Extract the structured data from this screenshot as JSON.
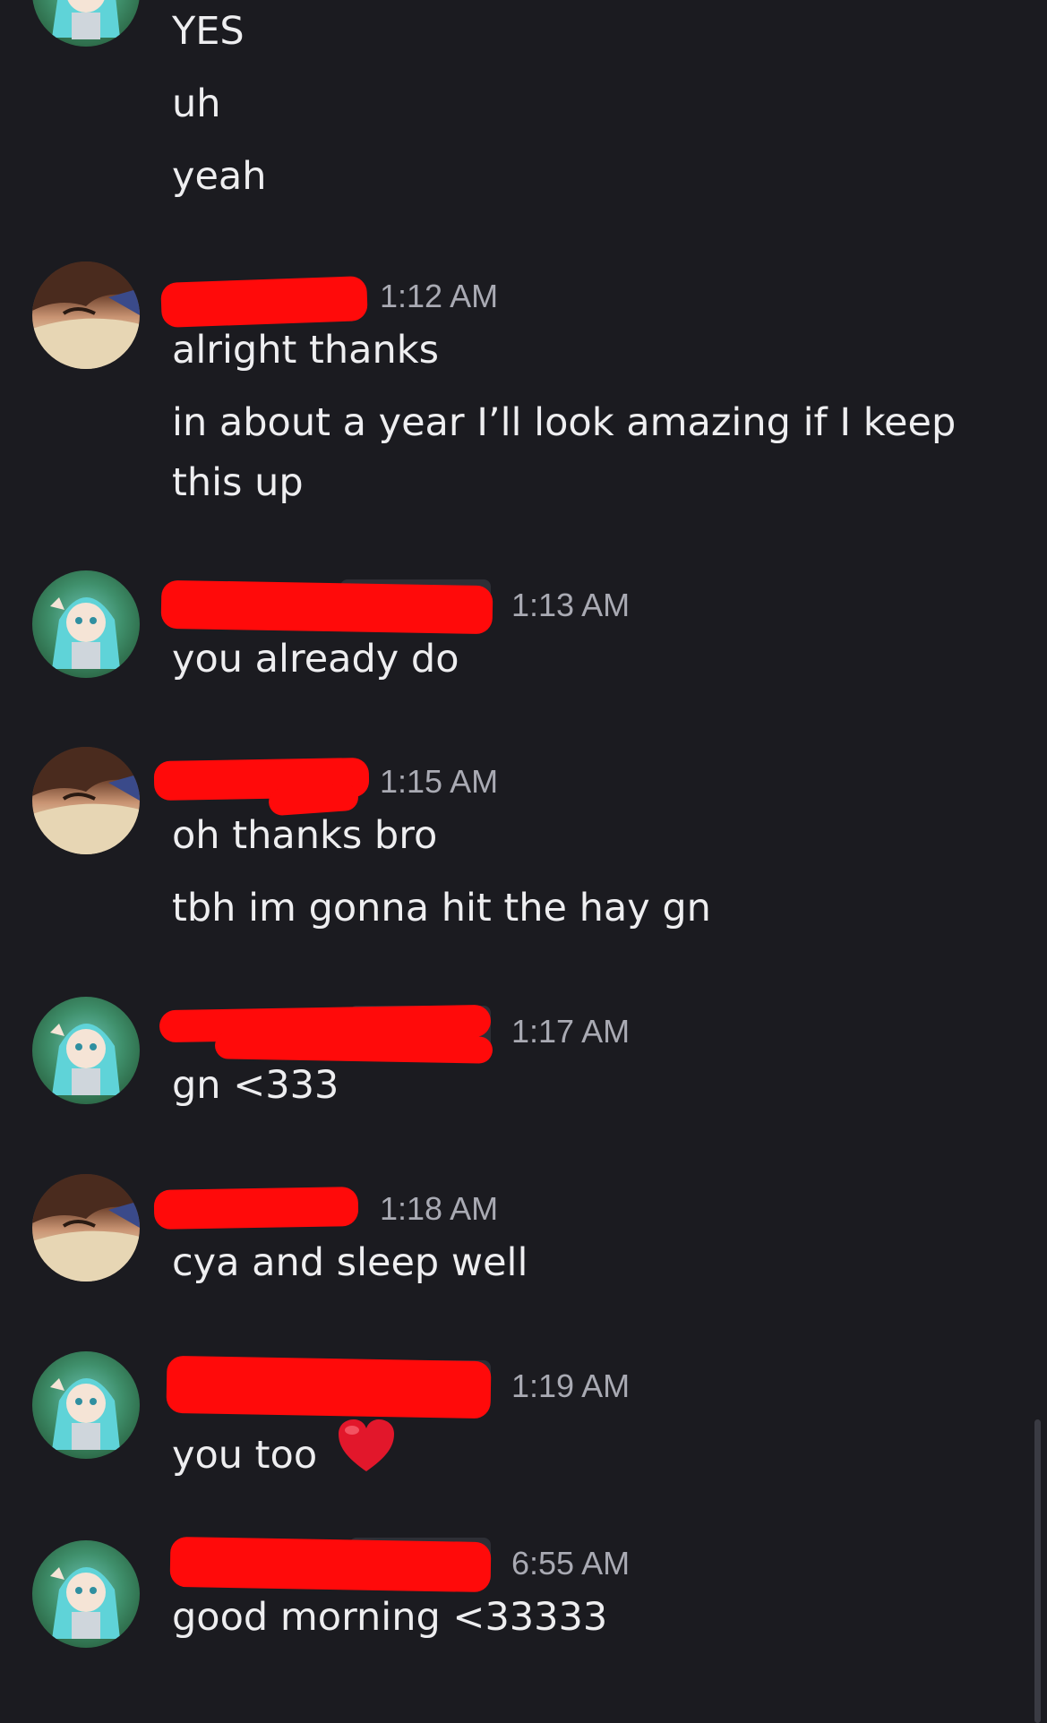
{
  "messages": [
    {
      "user": "miku",
      "lines": [
        "YES",
        "uh",
        "yeah"
      ]
    },
    {
      "user": "brown",
      "time": "1:12 AM",
      "lines": [
        "alright thanks",
        "in about a year I’ll look amazing if I keep",
        "this up"
      ]
    },
    {
      "user": "miku",
      "time": "1:13 AM",
      "lines": [
        "you already do"
      ]
    },
    {
      "user": "brown",
      "time": "1:15 AM",
      "lines": [
        "oh thanks bro",
        "tbh im gonna hit the hay gn"
      ]
    },
    {
      "user": "miku",
      "time": "1:17 AM",
      "lines": [
        "gn <333"
      ]
    },
    {
      "user": "brown",
      "time": "1:18 AM",
      "lines": [
        "cya and sleep well"
      ]
    },
    {
      "user": "miku",
      "time": "1:19 AM",
      "lines": [
        "you too"
      ],
      "emoji": "red-heart-icon"
    },
    {
      "user": "miku",
      "time": "6:55 AM",
      "lines": [
        "good morning <33333"
      ]
    }
  ],
  "colors": {
    "background": "#1b1b20",
    "text": "#eeeef0",
    "timestamp": "#a9aab3",
    "redaction": "#ff0a0a"
  }
}
